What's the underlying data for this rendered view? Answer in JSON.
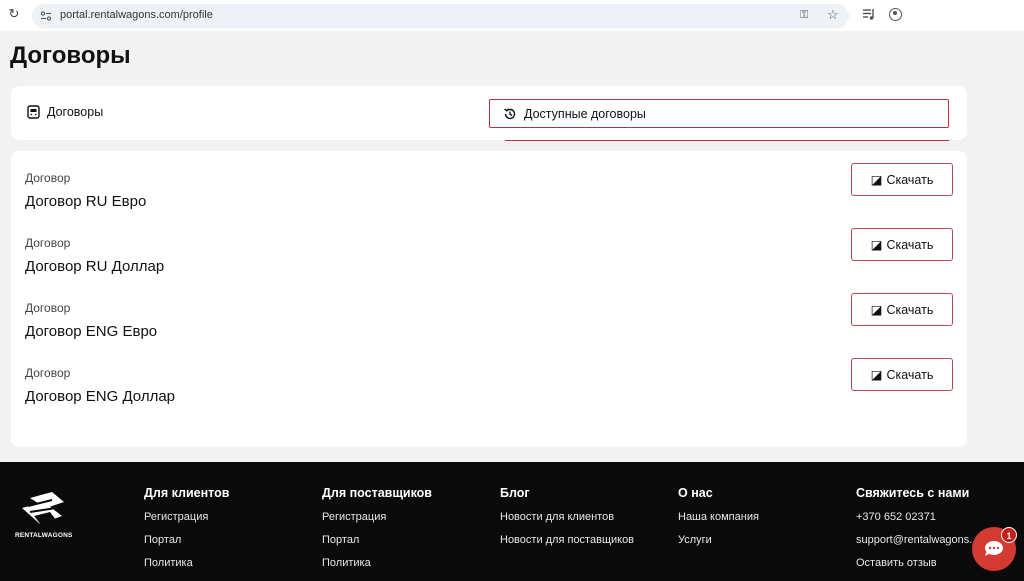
{
  "browser": {
    "url": "portal.rentalwagons.com/profile"
  },
  "page": {
    "title": "Договоры"
  },
  "tabs": [
    {
      "label": "Договоры",
      "icon": "document-icon",
      "active": false
    },
    {
      "label": "Доступные договоры",
      "icon": "history-icon",
      "active": true
    }
  ],
  "contracts": [
    {
      "label": "Договор",
      "name": "Договор RU Евро",
      "button": "Скачать"
    },
    {
      "label": "Договор",
      "name": "Договор RU Доллар",
      "button": "Скачать"
    },
    {
      "label": "Договор",
      "name": "Договор ENG Евро",
      "button": "Скачать"
    },
    {
      "label": "Договор",
      "name": "Договор ENG Доллар",
      "button": "Скачать"
    }
  ],
  "footer": {
    "logo_text": "RENTALWAGONS",
    "columns": [
      {
        "title": "Для клиентов",
        "links": [
          "Регистрация",
          "Портал",
          "Политика"
        ]
      },
      {
        "title": "Для поставщиков",
        "links": [
          "Регистрация",
          "Портал",
          "Политика"
        ]
      },
      {
        "title": "Блог",
        "links": [
          "Новости для клиентов",
          "Новости для поставщиков"
        ]
      },
      {
        "title": "О нас",
        "links": [
          "Наша компания",
          "Услуги"
        ]
      },
      {
        "title": "Свяжитесь с нами",
        "links": [
          "+370 652 02371",
          "support@rentalwagons.",
          "Оставить отзыв"
        ]
      }
    ]
  },
  "chat": {
    "badge": "1"
  },
  "colors": {
    "accent": "#c0303c",
    "footer_bg": "#0a0a0a",
    "chat": "#d33a32"
  }
}
